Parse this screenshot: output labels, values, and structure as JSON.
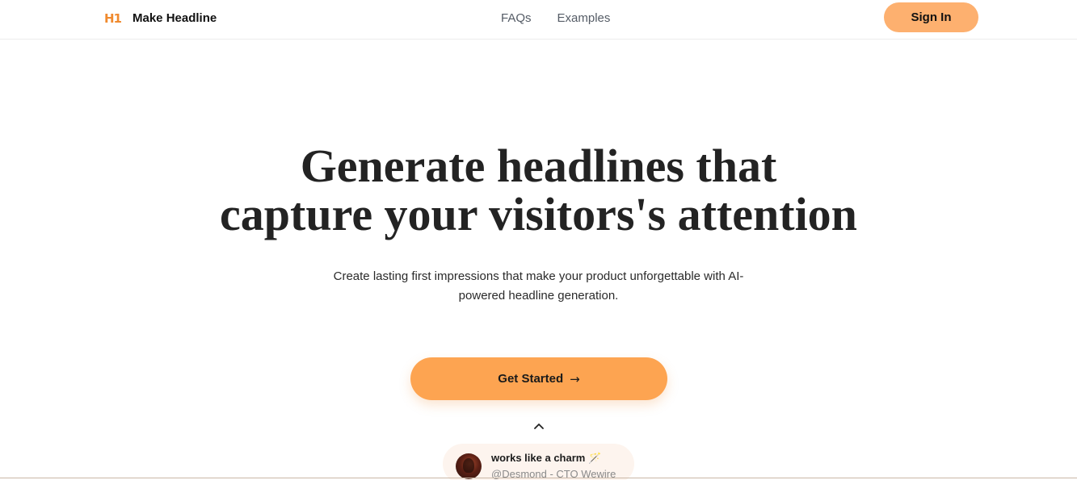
{
  "header": {
    "brand_icon": "H1",
    "brand_name": "Make Headline",
    "nav": [
      {
        "label": "FAQs"
      },
      {
        "label": "Examples"
      }
    ],
    "signin_label": "Sign In"
  },
  "hero": {
    "title_line1": "Generate headlines that",
    "title_line2": "capture your visitors's attention",
    "subtitle_line1": "Create lasting first impressions that make your product unforgettable with AI-",
    "subtitle_line2": "powered headline generation.",
    "cta_label": "Get Started",
    "cta_icon": "arrow-right-icon",
    "collapse_icon": "chevron-up-icon"
  },
  "testimonial": {
    "quote": "works like a charm 🪄",
    "author": "@Desmond - CTO Wewire"
  },
  "colors": {
    "accent": "#fda451",
    "signin_bg": "#fdb06f",
    "brand_icon": "#f08a2e",
    "testimonial_bg": "#fdf4ee"
  }
}
